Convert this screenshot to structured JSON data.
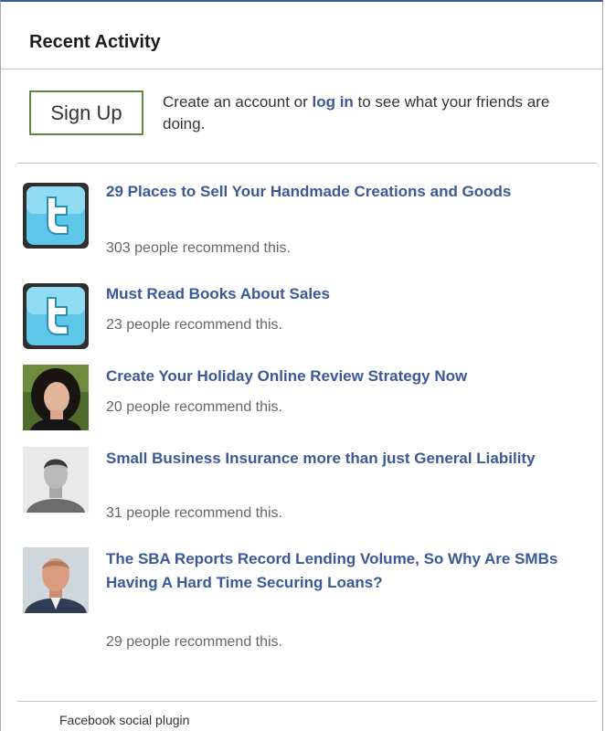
{
  "header": {
    "title": "Recent Activity"
  },
  "signup": {
    "button_label": "Sign Up",
    "text_prefix": "Create an account or ",
    "login_link": "log in",
    "text_suffix": " to see what your friends are doing."
  },
  "items": [
    {
      "title": "29 Places to Sell Your Handmade Creations and Goods",
      "count": "303 people recommend this.",
      "thumb": "twitter-logo"
    },
    {
      "title": "Must Read Books About Sales",
      "count": "23 people recommend this.",
      "thumb": "twitter-logo"
    },
    {
      "title": "Create Your Holiday Online Review Strategy Now",
      "count": "20 people recommend this.",
      "thumb": "woman-portrait"
    },
    {
      "title": "Small Business Insurance more than just General Liability",
      "count": "31 people recommend this.",
      "thumb": "man-portrait"
    },
    {
      "title": "The SBA Reports Record Lending Volume, So Why Are SMBs Having A Hard Time Securing Loans?",
      "count": "29 people recommend this.",
      "thumb": "man-portrait"
    }
  ],
  "footer": {
    "text": "Facebook social plugin"
  },
  "colors": {
    "accent": "#3b5998",
    "signup_border": "#5b8a3c",
    "muted": "#666666"
  }
}
